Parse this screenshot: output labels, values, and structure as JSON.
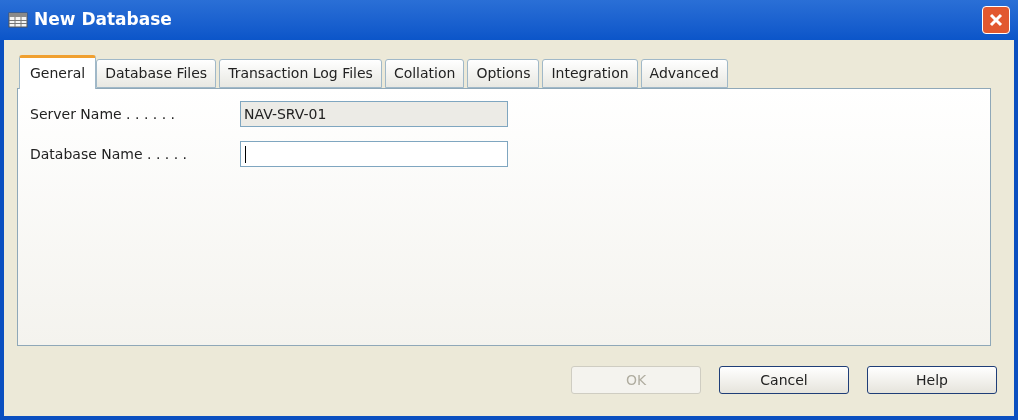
{
  "window": {
    "title": "New Database"
  },
  "tabs": [
    {
      "label": "General",
      "selected": true
    },
    {
      "label": "Database Files",
      "selected": false
    },
    {
      "label": "Transaction Log Files",
      "selected": false
    },
    {
      "label": "Collation",
      "selected": false
    },
    {
      "label": "Options",
      "selected": false
    },
    {
      "label": "Integration",
      "selected": false
    },
    {
      "label": "Advanced",
      "selected": false
    }
  ],
  "fields": [
    {
      "label": "Server Name . . . . . .",
      "value": "NAV-SRV-01",
      "read_only": true,
      "focused": false
    },
    {
      "label": "Database Name . . . . .",
      "read_only": false,
      "focused": true
    }
  ],
  "buttons": [
    {
      "label": "OK",
      "disabled": true
    },
    {
      "label": "Cancel",
      "disabled": false
    },
    {
      "label": "Help",
      "disabled": false
    }
  ]
}
